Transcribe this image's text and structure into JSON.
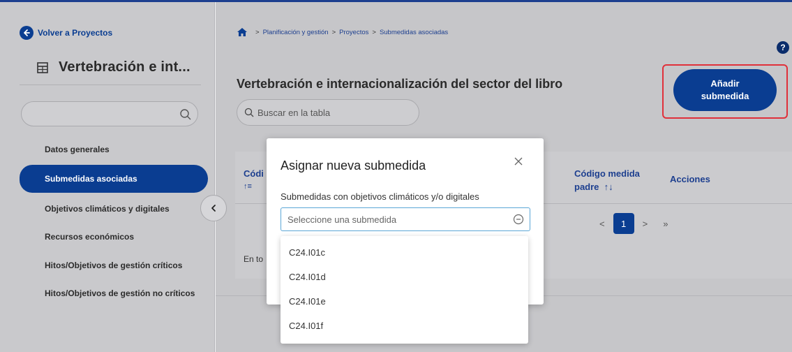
{
  "sidebar": {
    "back_label": "Volver a Proyectos",
    "project_title": "Vertebración e int...",
    "search_value": "",
    "items": [
      {
        "label": "Datos generales"
      },
      {
        "label": "Submedidas asociadas",
        "active": true
      },
      {
        "label": "Objetivos climáticos y digitales"
      },
      {
        "label": "Recursos económicos"
      },
      {
        "label": "Hitos/Objetivos de gestión críticos"
      },
      {
        "label": "Hitos/Objetivos de gestión no críticos"
      }
    ]
  },
  "breadcrumb": {
    "items": [
      "Planificación y gestión",
      "Proyectos",
      "Submedidas asociadas"
    ],
    "separator": ">"
  },
  "main": {
    "title": "Vertebración e internacionalización del sector del libro",
    "add_button_line1": "Añadir",
    "add_button_line2": "submedida",
    "search_placeholder": "Buscar en la tabla",
    "help": "?",
    "table": {
      "col_codigo": "Códi",
      "col_padre_line1": "Código medida",
      "col_padre_line2": "padre",
      "col_padre_sort": "↑↓",
      "col_acciones": "Acciones",
      "sort_icon": "↑≡",
      "total_prefix": "En to"
    },
    "pager": {
      "first": "<",
      "page": "1",
      "next": ">",
      "last": "»"
    }
  },
  "modal": {
    "title": "Asignar nueva submedida",
    "field_label": "Submedidas con objetivos climáticos y/o digitales",
    "select_placeholder": "Seleccione una submedida",
    "options": [
      "C24.I01c",
      "C24.I01d",
      "C24.I01e",
      "C24.I01f"
    ]
  },
  "colors": {
    "primary": "#0a3d91",
    "highlight": "#e0303a",
    "select_border": "#5ba6d6"
  }
}
